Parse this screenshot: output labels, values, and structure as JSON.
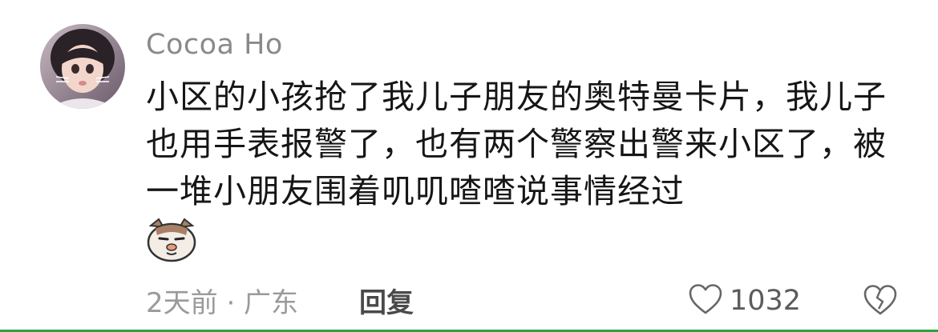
{
  "comment": {
    "username": "Cocoa Ho",
    "text": "小区的小孩抢了我儿子朋友的奥特曼卡片，我儿子也用手表报警了，也有两个警察出警来小区了，被一堆小朋友围着叽叽喳喳说事情经过",
    "sticker_icon": "cat-face-sticker-icon",
    "time_location": "2天前 · 广东",
    "reply_label": "回复",
    "like_count": "1032",
    "like_icon": "heart-outline-icon",
    "dislike_icon": "broken-heart-icon"
  },
  "colors": {
    "accent_line": "#2fa043",
    "username": "#8a8a8a",
    "text": "#161616"
  }
}
